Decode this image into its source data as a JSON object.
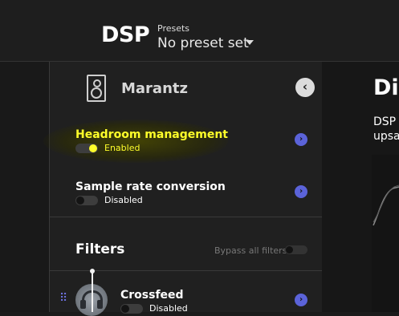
{
  "header": {
    "title": "DSP",
    "presets_label": "Presets",
    "preset_value": "No preset set"
  },
  "panel": {
    "device_name": "Marantz",
    "rows": [
      {
        "title": "Headroom management",
        "status": "Enabled",
        "enabled": true
      },
      {
        "title": "Sample rate conversion",
        "status": "Disabled",
        "enabled": false
      }
    ],
    "filters": {
      "title": "Filters",
      "bypass_label": "Bypass all filters",
      "items": [
        {
          "title": "Crossfeed",
          "status": "Disabled",
          "enabled": false
        }
      ]
    }
  },
  "right_pane": {
    "title": "Dig",
    "line1": "DSP",
    "line2": "upsa"
  },
  "icons": {
    "back": "chevron-left-icon",
    "go": "chevron-right-icon",
    "dropdown": "chevron-down-icon",
    "speaker": "speaker-icon",
    "filter": "headphones-icon",
    "drag": "drag-handle-icon"
  },
  "colors": {
    "accent_yellow": "#ffff2a",
    "accent_blue": "#5b63d9"
  }
}
